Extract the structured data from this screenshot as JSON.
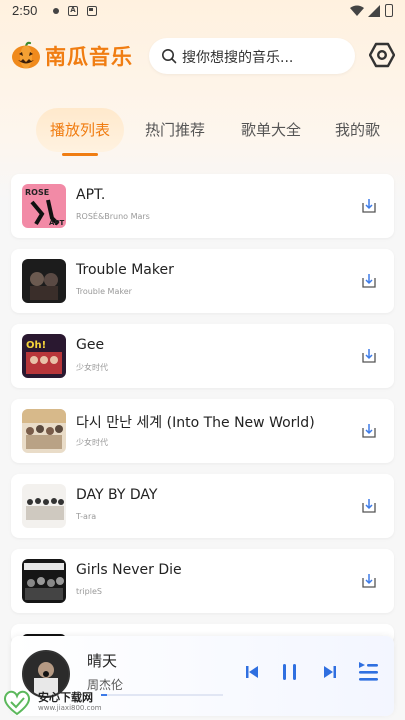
{
  "status_bar": {
    "time": "2:50"
  },
  "app": {
    "name": "南瓜音乐"
  },
  "search": {
    "placeholder": "搜你想搜的音乐..."
  },
  "tabs": [
    {
      "label": "播放列表",
      "active": true
    },
    {
      "label": "热门推荐",
      "active": false
    },
    {
      "label": "歌单大全",
      "active": false
    },
    {
      "label": "我的歌",
      "active": false
    }
  ],
  "songs": [
    {
      "title": "APT.",
      "artist": "ROSÉ&Bruno Mars"
    },
    {
      "title": "Trouble Maker",
      "artist": "Trouble Maker"
    },
    {
      "title": "Gee",
      "artist": "少女时代"
    },
    {
      "title": "다시 만난 세계 (Into The New World)",
      "artist": "少女时代"
    },
    {
      "title": "DAY BY DAY",
      "artist": "T-ara"
    },
    {
      "title": "Girls Never Die",
      "artist": "tripleS"
    }
  ],
  "player": {
    "title": "晴天",
    "artist": "周杰伦",
    "progress": 0.05
  },
  "watermark": {
    "text": "安心下载网",
    "url": "www.jiaxi800.com",
    "brand": "安心"
  },
  "colors": {
    "accent": "#f07d12",
    "player_blue": "#2f6fe0"
  }
}
